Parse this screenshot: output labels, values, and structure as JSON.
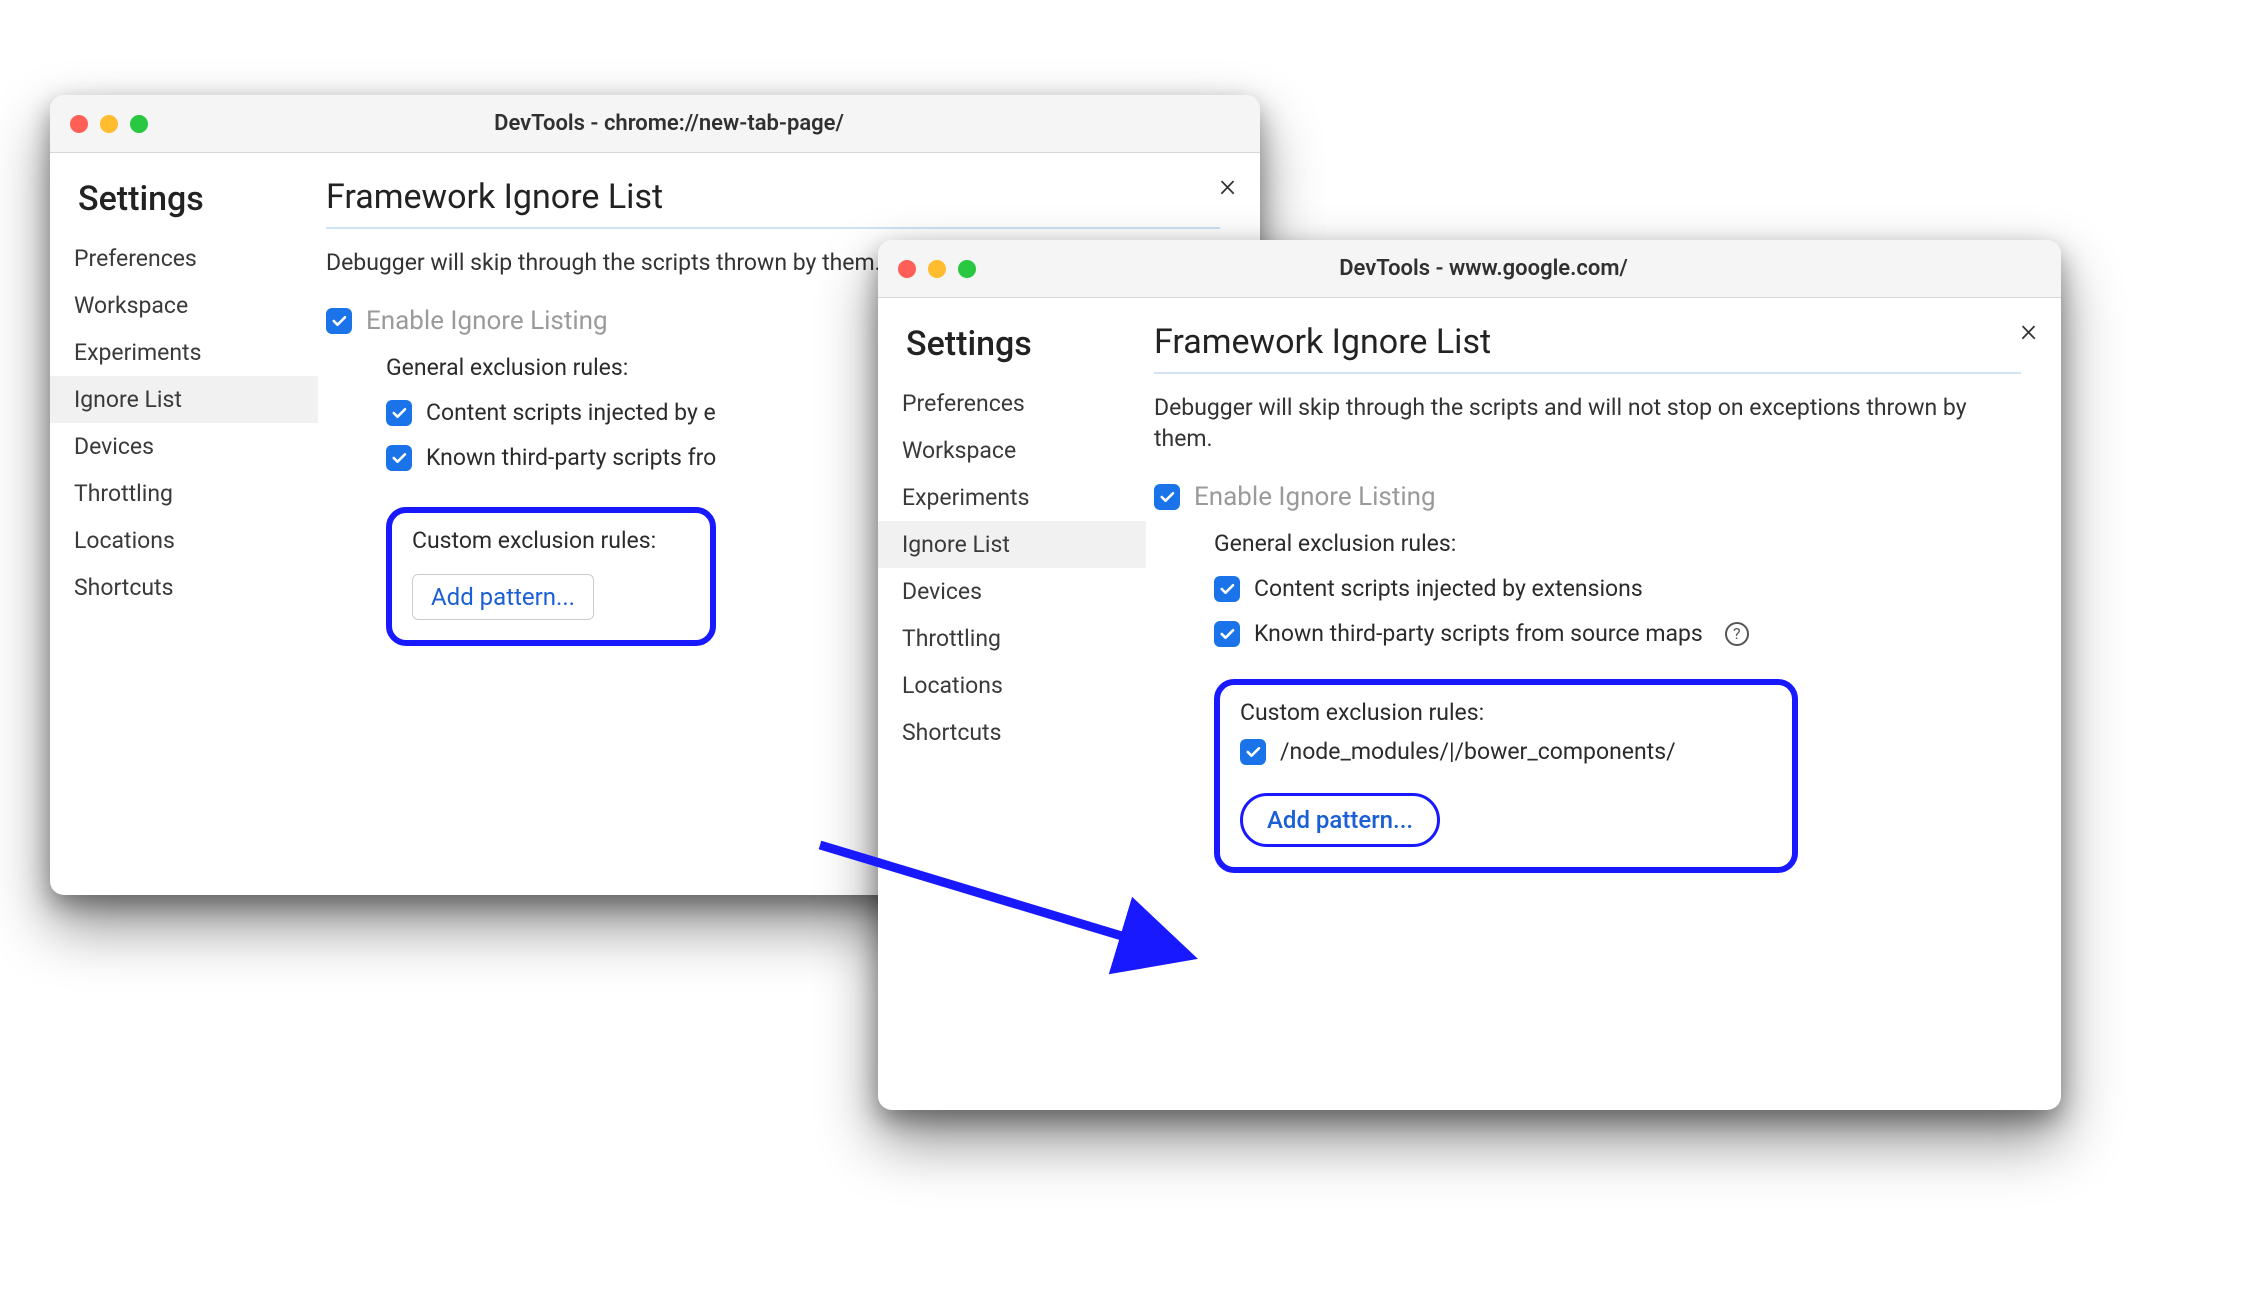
{
  "colors": {
    "accent": "#1a73e8",
    "highlight": "#1919ff"
  },
  "w1": {
    "title": "DevTools - chrome://new-tab-page/",
    "sidebar_title": "Settings",
    "sidebar_items": [
      "Preferences",
      "Workspace",
      "Experiments",
      "Ignore List",
      "Devices",
      "Throttling",
      "Locations",
      "Shortcuts"
    ],
    "active_index": 3,
    "main_title": "Framework Ignore List",
    "description": "Debugger will skip through the scripts thrown by them.",
    "enable_label": "Enable Ignore Listing",
    "general_heading": "General exclusion rules:",
    "rule_content_scripts": "Content scripts injected by e",
    "rule_third_party": "Known third-party scripts fro",
    "custom_heading": "Custom exclusion rules:",
    "add_pattern": "Add pattern..."
  },
  "w2": {
    "title": "DevTools - www.google.com/",
    "sidebar_title": "Settings",
    "sidebar_items": [
      "Preferences",
      "Workspace",
      "Experiments",
      "Ignore List",
      "Devices",
      "Throttling",
      "Locations",
      "Shortcuts"
    ],
    "active_index": 3,
    "main_title": "Framework Ignore List",
    "description": "Debugger will skip through the scripts and will not stop on exceptions thrown by them.",
    "enable_label": "Enable Ignore Listing",
    "general_heading": "General exclusion rules:",
    "rule_content_scripts": "Content scripts injected by extensions",
    "rule_third_party": "Known third-party scripts from source maps",
    "custom_heading": "Custom exclusion rules:",
    "pattern_value": "/node_modules/|/bower_components/",
    "add_pattern": "Add pattern..."
  }
}
